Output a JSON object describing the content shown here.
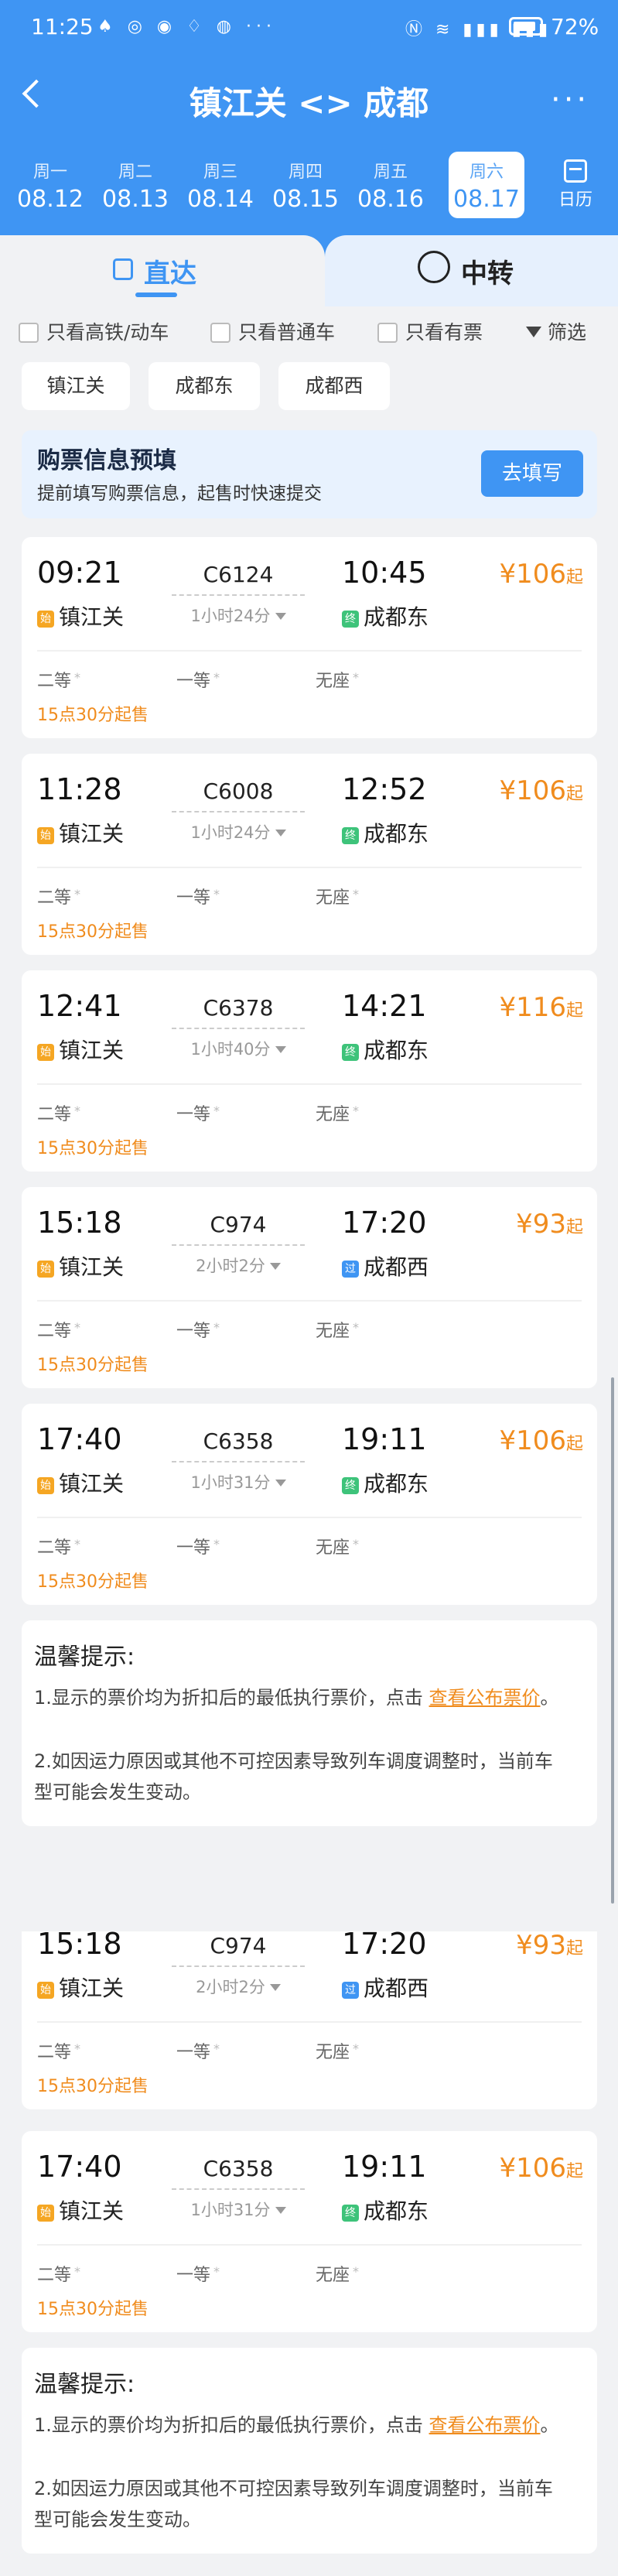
{
  "status_bar": {
    "time": "11:25",
    "app_icons": "♠ ◎ ◉ ♢ ◍ ···",
    "sys_icons": "Ⓝ ≋ ▮▮▮ ▮▮▮",
    "battery": "72%"
  },
  "header": {
    "title": "镇江关 <> 成都",
    "more": "···"
  },
  "dates": [
    {
      "weekday": "周一",
      "date": "08.12"
    },
    {
      "weekday": "周二",
      "date": "08.13"
    },
    {
      "weekday": "周三",
      "date": "08.14"
    },
    {
      "weekday": "周四",
      "date": "08.15"
    },
    {
      "weekday": "周五",
      "date": "08.16"
    },
    {
      "weekday": "周六",
      "date": "08.17"
    }
  ],
  "calendar_label": "日历",
  "tabs": {
    "direct": "直达",
    "transfer": "中转"
  },
  "filters": {
    "high_speed": "只看高铁/动车",
    "normal": "只看普通车",
    "available": "只看有票",
    "filter": "筛选",
    "stations": [
      "镇江关",
      "成都东",
      "成都西"
    ]
  },
  "banner": {
    "title": "购票信息预填",
    "subtitle": "提前填写购票信息，起售时快速提交",
    "button": "去填写"
  },
  "trains": [
    {
      "dep": "09:21",
      "num": "C6124",
      "dur": "1小时24分",
      "arr": "10:45",
      "from": "镇江关",
      "to": "成都东",
      "to_tag": "终",
      "price": "¥106",
      "suffix": "起",
      "seats": [
        "二等",
        "一等",
        "无座"
      ],
      "sale": "15点30分起售"
    },
    {
      "dep": "11:28",
      "num": "C6008",
      "dur": "1小时24分",
      "arr": "12:52",
      "from": "镇江关",
      "to": "成都东",
      "to_tag": "终",
      "price": "¥106",
      "suffix": "起",
      "seats": [
        "二等",
        "一等",
        "无座"
      ],
      "sale": "15点30分起售"
    },
    {
      "dep": "12:41",
      "num": "C6378",
      "dur": "1小时40分",
      "arr": "14:21",
      "from": "镇江关",
      "to": "成都东",
      "to_tag": "终",
      "price": "¥116",
      "suffix": "起",
      "seats": [
        "二等",
        "一等",
        "无座"
      ],
      "sale": "15点30分起售"
    },
    {
      "dep": "15:18",
      "num": "C974",
      "dur": "2小时2分",
      "arr": "17:20",
      "from": "镇江关",
      "to": "成都西",
      "to_tag": "过",
      "price": "¥93",
      "suffix": "起",
      "seats": [
        "二等",
        "一等",
        "无座"
      ],
      "sale": "15点30分起售"
    },
    {
      "dep": "17:40",
      "num": "C6358",
      "dur": "1小时31分",
      "arr": "19:11",
      "from": "镇江关",
      "to": "成都东",
      "to_tag": "终",
      "price": "¥106",
      "suffix": "起",
      "seats": [
        "二等",
        "一等",
        "无座"
      ],
      "sale": "15点30分起售"
    }
  ],
  "start_tag": "始",
  "tips": {
    "heading": "温馨提示:",
    "line1_pre": "1.显示的票价均为折扣后的最低执行票价，点击 ",
    "line1_link": "查看公布票价",
    "line1_post": "。",
    "line2": "2.如因运力原因或其他不可控因素导致列车调度调整时，当前车型可能会发生变动。"
  }
}
